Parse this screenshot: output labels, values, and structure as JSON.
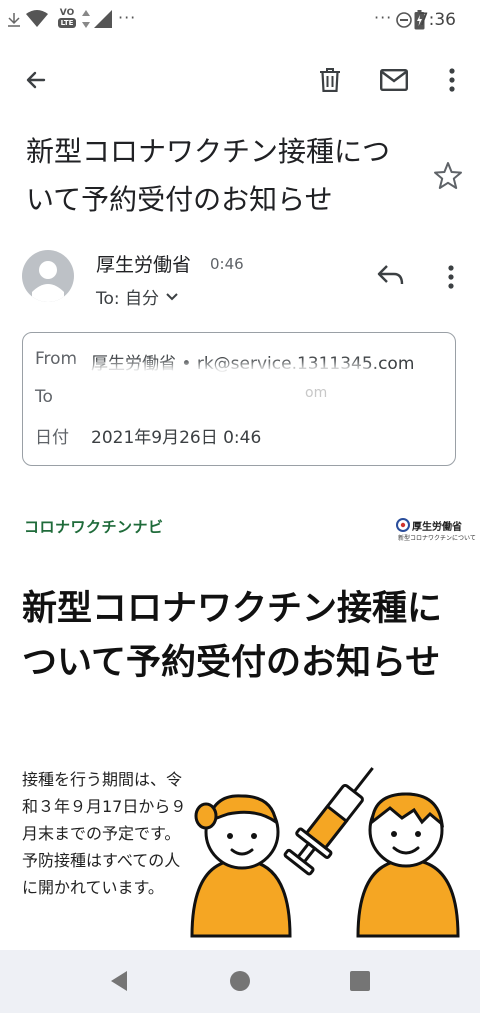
{
  "status_bar": {
    "time": "7:36",
    "left_dots": "···",
    "right_dots": "···",
    "volte_label": "VO",
    "lte_label": "LTE",
    "icons": [
      "wifi-icon",
      "signal-icon",
      "dnd-icon",
      "battery-charging-icon"
    ]
  },
  "toolbar": {
    "back_icon": "arrow-left-icon",
    "delete_icon": "trash-icon",
    "mark_unread_icon": "mail-icon",
    "more_icon": "more-vert-icon"
  },
  "email": {
    "subject": "新型コロナワクチン接種について予約受付のお知らせ",
    "sender_name": "厚生労働省",
    "sender_time": "0:46",
    "to_line": "To: 自分",
    "details": {
      "from_label": "From",
      "from_value": "厚生労働省 • rk@service.1311345.com",
      "to_label": "To",
      "to_value_tail": "om",
      "date_label": "日付",
      "date_value": "2021年9月26日 0:46"
    }
  },
  "body": {
    "brand": "コロナワクチンナビ",
    "logo_name": "厚生労働省",
    "logo_sub": "新型コロナワクチンについて",
    "headline": "新型コロナワクチン接種について予約受付のお知らせ",
    "paragraph": "接種を行う期間は、令和３年９月17日から９月末までの予定です。予防接種はすべての人に開かれています。"
  },
  "colors": {
    "brand_green": "#1f6b3a",
    "illustration_orange": "#f5a623",
    "avatar_gray": "#bdc1c6"
  },
  "nav": {
    "back_icon": "triangle-back-icon",
    "home_icon": "circle-home-icon",
    "recents_icon": "square-recents-icon"
  }
}
